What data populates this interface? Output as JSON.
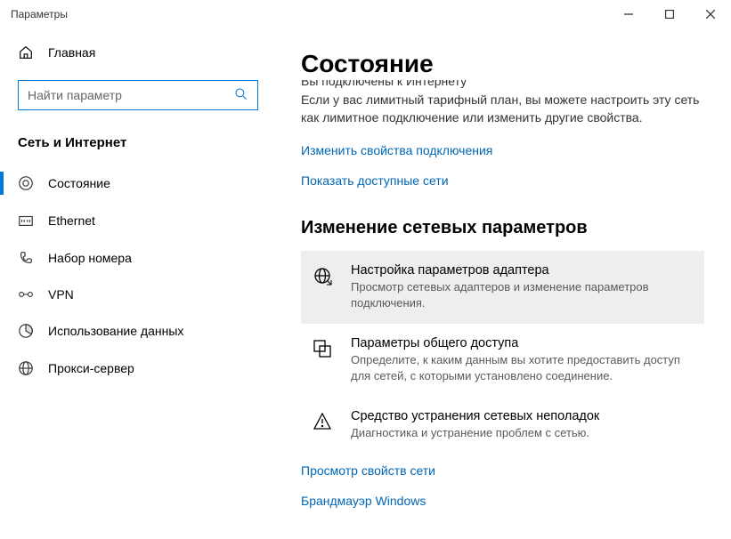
{
  "window": {
    "title": "Параметры"
  },
  "sidebar": {
    "home": "Главная",
    "search_placeholder": "Найти параметр",
    "category": "Сеть и Интернет",
    "items": [
      {
        "label": "Состояние"
      },
      {
        "label": "Ethernet"
      },
      {
        "label": "Набор номера"
      },
      {
        "label": "VPN"
      },
      {
        "label": "Использование данных"
      },
      {
        "label": "Прокси-сервер"
      }
    ]
  },
  "content": {
    "heading": "Состояние",
    "clipped_line": "Вы подключены к Интернету",
    "description": "Если у вас лимитный тарифный план, вы можете настроить эту сеть как лимитное подключение или изменить другие свойства.",
    "link_change": "Изменить свойства подключения",
    "link_show": "Показать доступные сети",
    "section": "Изменение сетевых параметров",
    "rows": [
      {
        "label": "Настройка параметров адаптера",
        "sub": "Просмотр сетевых адаптеров и изменение параметров подключения."
      },
      {
        "label": "Параметры общего доступа",
        "sub": "Определите, к каким данным вы хотите предоставить доступ для сетей, с которыми установлено соединение."
      },
      {
        "label": "Средство устранения сетевых неполадок",
        "sub": "Диагностика и устранение проблем с сетью."
      }
    ],
    "link_view": "Просмотр свойств сети",
    "link_firewall": "Брандмауэр Windows"
  }
}
